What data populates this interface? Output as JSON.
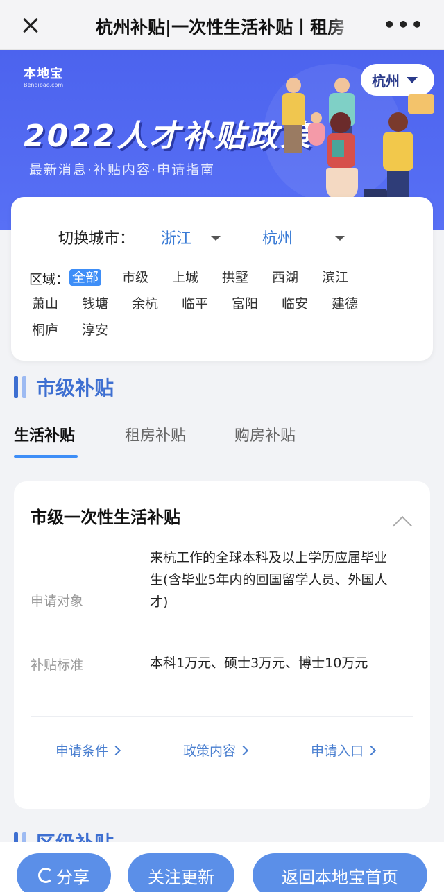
{
  "nav": {
    "title": "杭州补贴|一次性生活补贴丨租房"
  },
  "banner": {
    "logo_cn": "本地宝",
    "logo_en": "Bendibao.com",
    "title": "2022人才补贴政策",
    "subtitle": "最新消息·补贴内容·申请指南",
    "city": "杭州"
  },
  "filter": {
    "switch_label": "切换城市：",
    "province": "浙江",
    "city": "杭州",
    "region_label": "区域：",
    "regions": [
      "全部",
      "市级",
      "上城",
      "拱墅",
      "西湖",
      "滨江",
      "萧山",
      "钱塘",
      "余杭",
      "临平",
      "富阳",
      "临安",
      "建德",
      "桐庐",
      "淳安"
    ]
  },
  "section": {
    "title": "市级补贴",
    "next_title": "区级补贴"
  },
  "tabs": [
    "生活补贴",
    "租房补贴",
    "购房补贴"
  ],
  "card": {
    "title": "市级一次性生活补贴",
    "target_label": "申请对象",
    "target_value": "来杭工作的全球本科及以上学历应届毕业生(含毕业5年内的回国留学人员、外国人才)",
    "standard_label": "补贴标准",
    "standard_value": "本科1万元、硕士3万元、博士10万元",
    "links": [
      "申请条件",
      "政策内容",
      "申请入口"
    ]
  },
  "bottom": {
    "share": "分享",
    "follow": "关注更新",
    "home": "返回本地宝首页"
  }
}
